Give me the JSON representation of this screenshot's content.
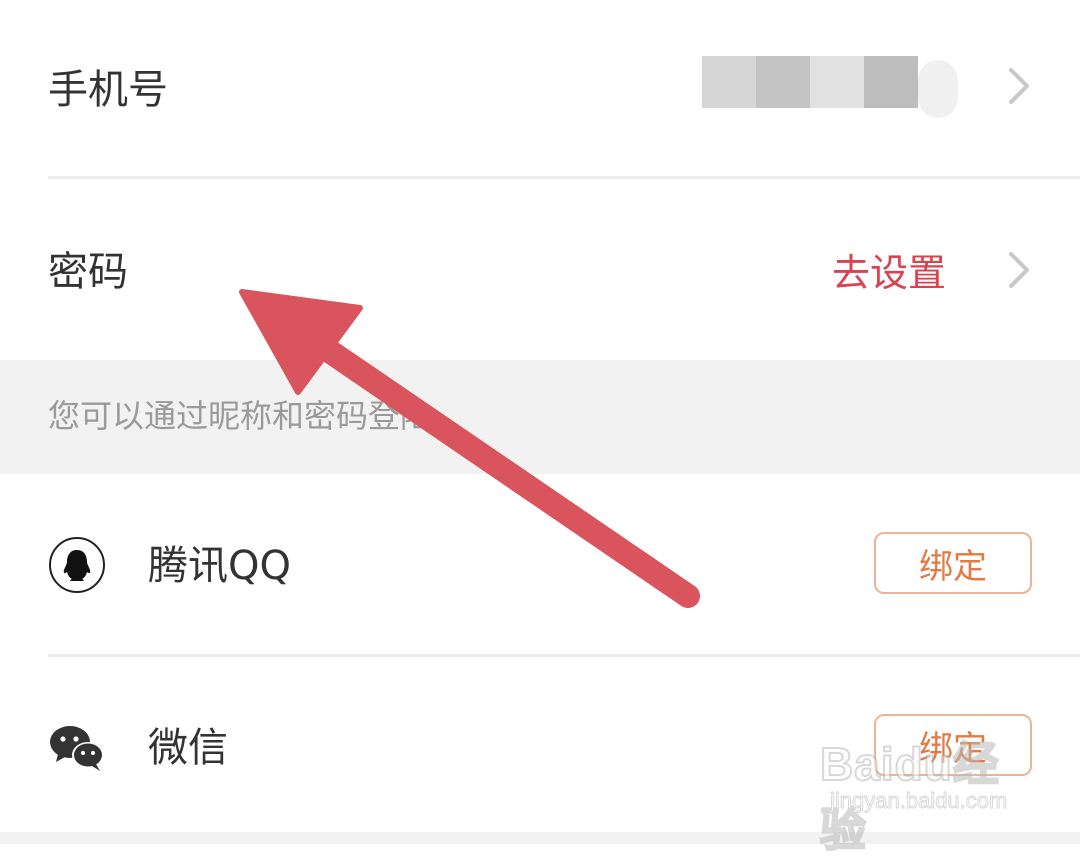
{
  "account": {
    "phone": {
      "label": "手机号"
    },
    "password": {
      "label": "密码",
      "action": "去设置"
    },
    "hint": "您可以通过昵称和密码登陆"
  },
  "social": [
    {
      "name": "腾讯QQ",
      "icon": "qq-penguin-icon",
      "button": "绑定"
    },
    {
      "name": "微信",
      "icon": "wechat-icon",
      "button": "绑定"
    }
  ],
  "watermark": {
    "brand": "Baidu经验",
    "url": "jingyan.baidu.com"
  },
  "colors": {
    "accent_red": "#d9434f",
    "bind_orange": "#e07b44",
    "arrow": "#d9545c"
  }
}
